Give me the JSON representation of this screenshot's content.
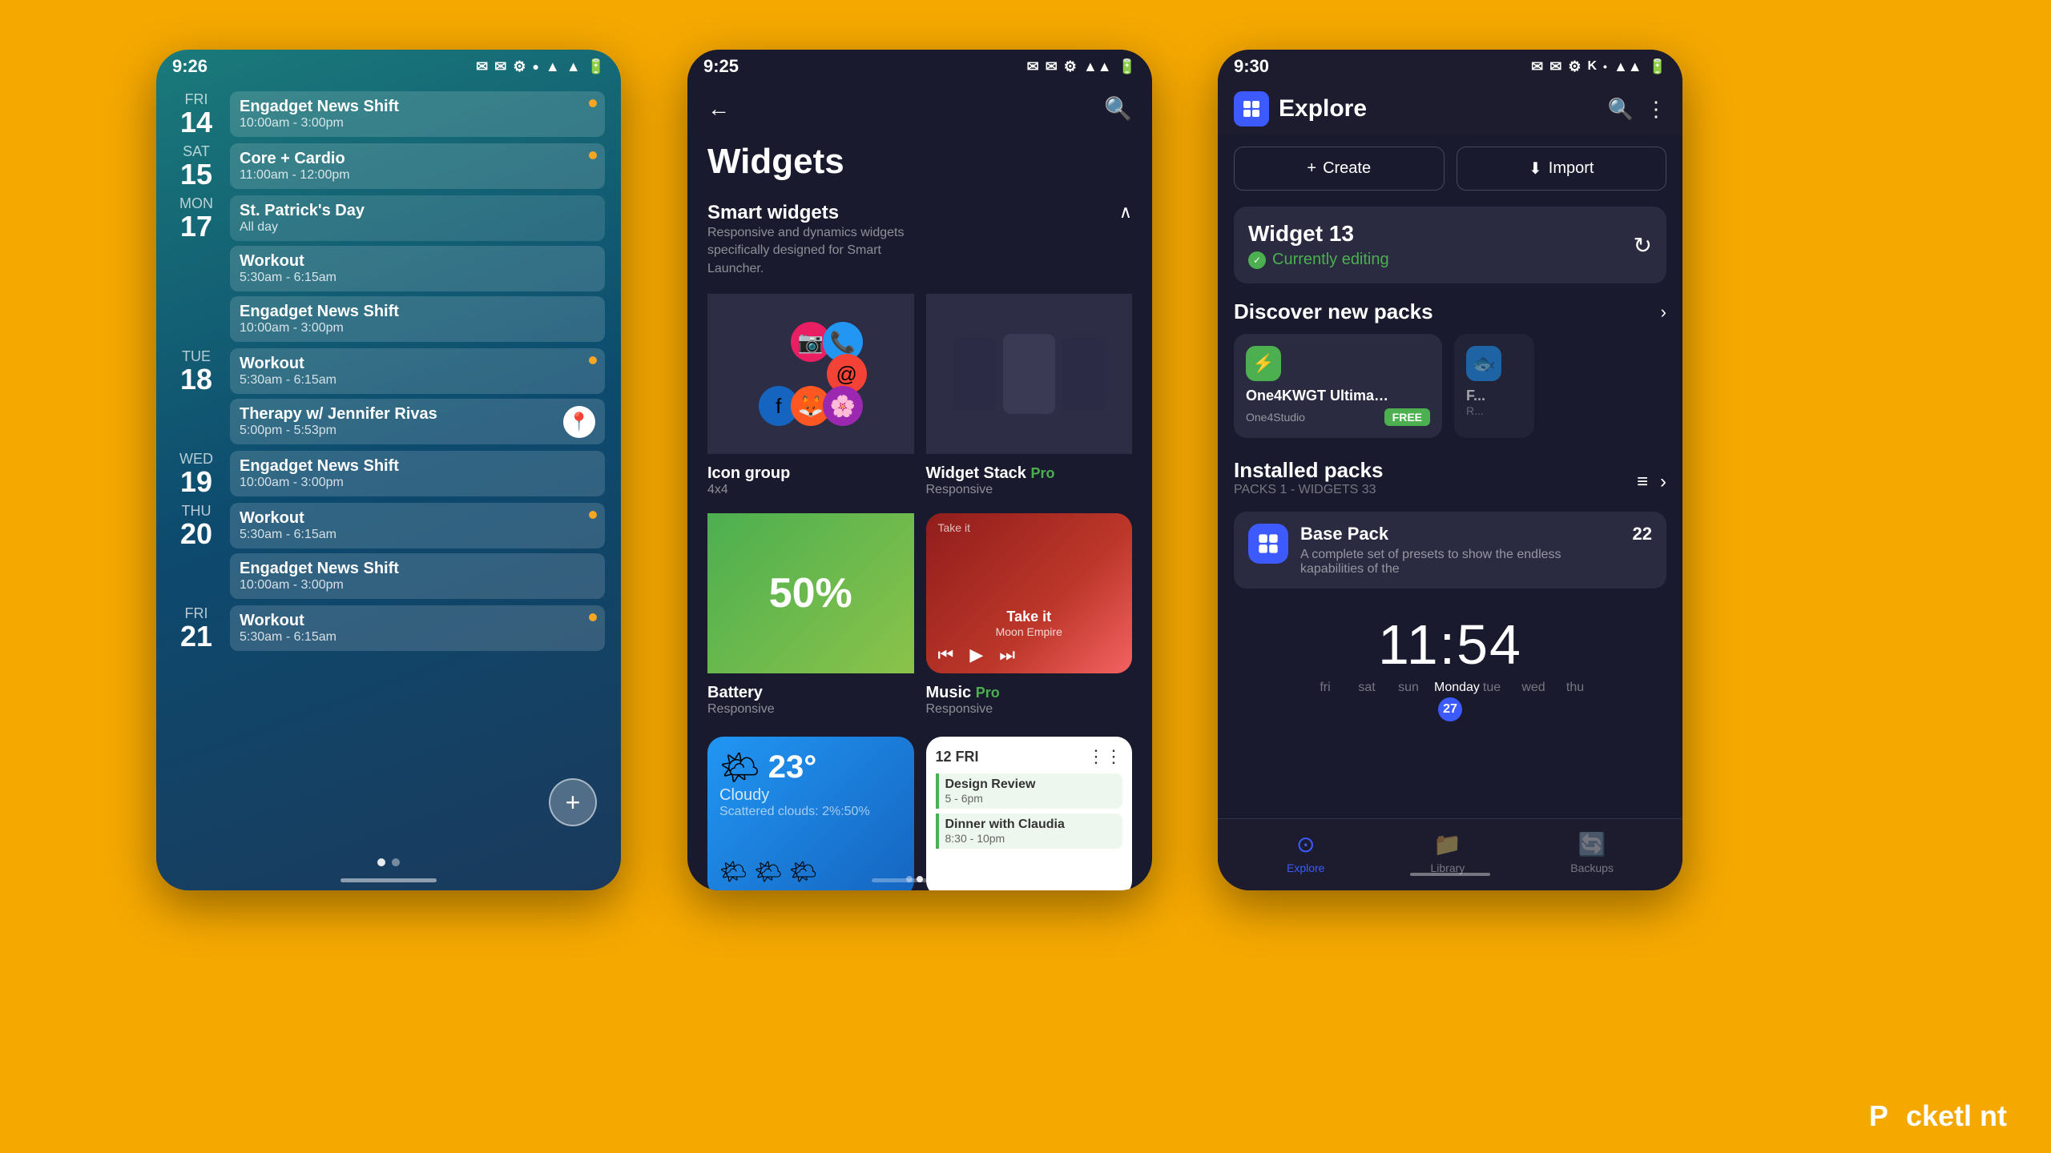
{
  "background": "#F5A800",
  "phone1": {
    "status": {
      "time": "9:26",
      "icons": [
        "📧",
        "📧",
        "⚙",
        "●"
      ],
      "signal": "▲▲▲",
      "battery": "🔋"
    },
    "events": [
      {
        "day_label": "FRI",
        "day_num": "14",
        "items": [
          {
            "name": "Engadget News Shift",
            "time": "10:00am - 3:00pm",
            "dot": true
          }
        ]
      },
      {
        "day_label": "SAT",
        "day_num": "15",
        "items": [
          {
            "name": "Core + Cardio",
            "time": "11:00am - 12:00pm",
            "dot": true
          }
        ]
      },
      {
        "day_label": "MON",
        "day_num": "17",
        "items": [
          {
            "name": "St. Patrick's Day",
            "time": "All day",
            "dot": false,
            "allday": true
          },
          {
            "name": "Workout",
            "time": "5:30am - 6:15am",
            "dot": false
          },
          {
            "name": "Engadget News Shift",
            "time": "10:00am - 3:00pm",
            "dot": false
          }
        ]
      },
      {
        "day_label": "TUE",
        "day_num": "18",
        "items": [
          {
            "name": "Workout",
            "time": "5:30am - 6:15am",
            "dot": true
          },
          {
            "name": "Therapy w/ Jennifer Rivas",
            "time": "5:00pm - 5:53pm",
            "map": true
          }
        ]
      },
      {
        "day_label": "WED",
        "day_num": "19",
        "items": [
          {
            "name": "Engadget News Shift",
            "time": "10:00am - 3:00pm",
            "dot": false
          }
        ]
      },
      {
        "day_label": "THU",
        "day_num": "20",
        "items": [
          {
            "name": "Workout",
            "time": "5:30am - 6:15am",
            "dot": true
          },
          {
            "name": "Engadget News Shift",
            "time": "10:00am - 3:00pm",
            "dot": false
          }
        ]
      },
      {
        "day_label": "FRI",
        "day_num": "21",
        "items": [
          {
            "name": "Workout",
            "time": "5:30am - 6:15am",
            "dot": true
          }
        ]
      }
    ]
  },
  "phone2": {
    "status": {
      "time": "9:25",
      "icons": [
        "📧",
        "📧",
        "⚙"
      ]
    },
    "title": "Widgets",
    "section": {
      "name": "Smart widgets",
      "desc": "Responsive and dynamics widgets specifically designed for Smart Launcher."
    },
    "widgets": [
      {
        "type": "icon_group",
        "label": "Icon group",
        "sub": "4x4"
      },
      {
        "type": "widget_stack",
        "label": "Widget Stack",
        "pro": true,
        "sub": "Responsive"
      },
      {
        "type": "battery",
        "label": "Battery",
        "sub": "Responsive",
        "value": "50%"
      },
      {
        "type": "music",
        "label": "Music",
        "pro": true,
        "sub": "Responsive",
        "song": "Take it",
        "artist": "Moon Empire"
      }
    ],
    "weather_widget": {
      "temp": "23°",
      "condition": "Cloudy",
      "detail": "Scattered clouds: 2%:50%"
    },
    "calendar_widget": {
      "date": "12 FRI",
      "events": [
        {
          "name": "Design Review",
          "time": "5 - 6pm"
        },
        {
          "name": "Dinner with Claudia",
          "time": "8:30 - 10pm"
        }
      ]
    }
  },
  "phone3": {
    "status": {
      "time": "9:30",
      "icons": [
        "📧",
        "📧",
        "⚙",
        "K"
      ]
    },
    "app_name": "Explore",
    "actions": {
      "create": "Create",
      "import": "Import"
    },
    "current_widget": {
      "name": "Widget 13",
      "status": "Currently editing"
    },
    "discover": {
      "title": "Discover new packs",
      "packs": [
        {
          "name": "One4KWGT Ultimate: KWG...",
          "studio": "One4Studio",
          "badge": "FREE",
          "icon_color": "green"
        },
        {
          "name": "F...",
          "studio": "R...",
          "icon_color": "blue"
        }
      ]
    },
    "installed": {
      "title": "Installed packs",
      "sub": "PACKS 1 - WIDGETS 33",
      "packs": [
        {
          "name": "Base Pack",
          "desc": "A complete set of presets to show the endless kapabilities of the",
          "count": "22"
        }
      ]
    },
    "clock": {
      "time": "11:54",
      "days": [
        {
          "label": "fri",
          "today": false
        },
        {
          "label": "sat",
          "today": false
        },
        {
          "label": "sun",
          "today": false
        },
        {
          "label": "Monday",
          "today": true,
          "num": "27"
        },
        {
          "label": "tue",
          "today": false
        },
        {
          "label": "wed",
          "today": false
        },
        {
          "label": "thu",
          "today": false
        }
      ]
    },
    "nav": {
      "items": [
        {
          "label": "Explore",
          "active": true,
          "icon": "⊙"
        },
        {
          "label": "Library",
          "active": false,
          "icon": "📁"
        },
        {
          "label": "Backups",
          "active": false,
          "icon": "🔄"
        }
      ]
    }
  },
  "pocketlint": "Pocketlint"
}
